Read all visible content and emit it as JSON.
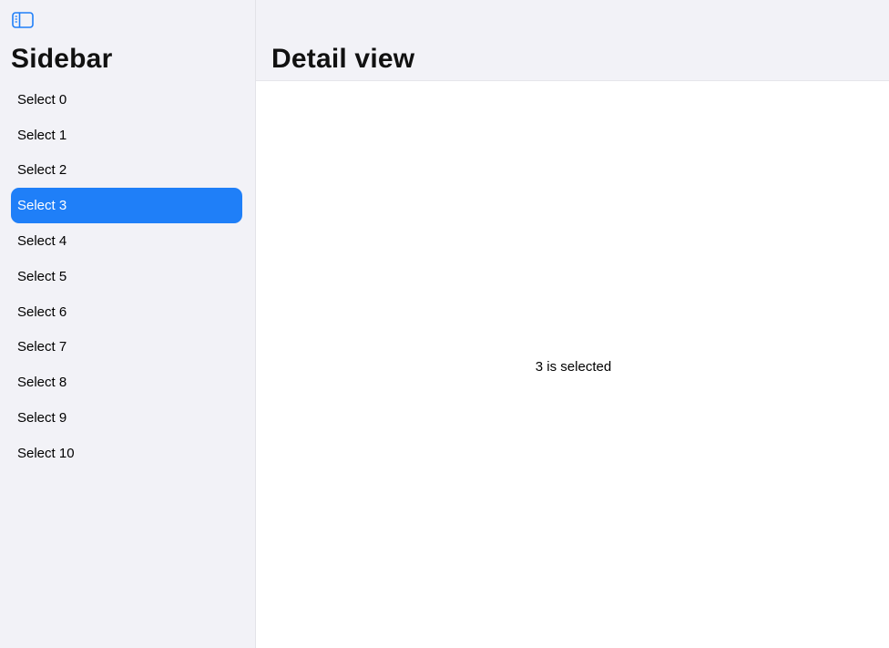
{
  "sidebar": {
    "toggle_icon": "sidebar-toggle-icon",
    "title": "Sidebar",
    "items": [
      {
        "label": "Select 0"
      },
      {
        "label": "Select 1"
      },
      {
        "label": "Select 2"
      },
      {
        "label": "Select 3",
        "selected": true
      },
      {
        "label": "Select 4"
      },
      {
        "label": "Select 5"
      },
      {
        "label": "Select 6"
      },
      {
        "label": "Select 7"
      },
      {
        "label": "Select 8"
      },
      {
        "label": "Select 9"
      },
      {
        "label": "Select 10"
      }
    ]
  },
  "detail": {
    "title": "Detail view",
    "message": "3 is selected"
  },
  "colors": {
    "accent": "#1f7ff8",
    "sidebar_background": "#f2f2f7",
    "icon_tint": "#1f7ff8"
  }
}
